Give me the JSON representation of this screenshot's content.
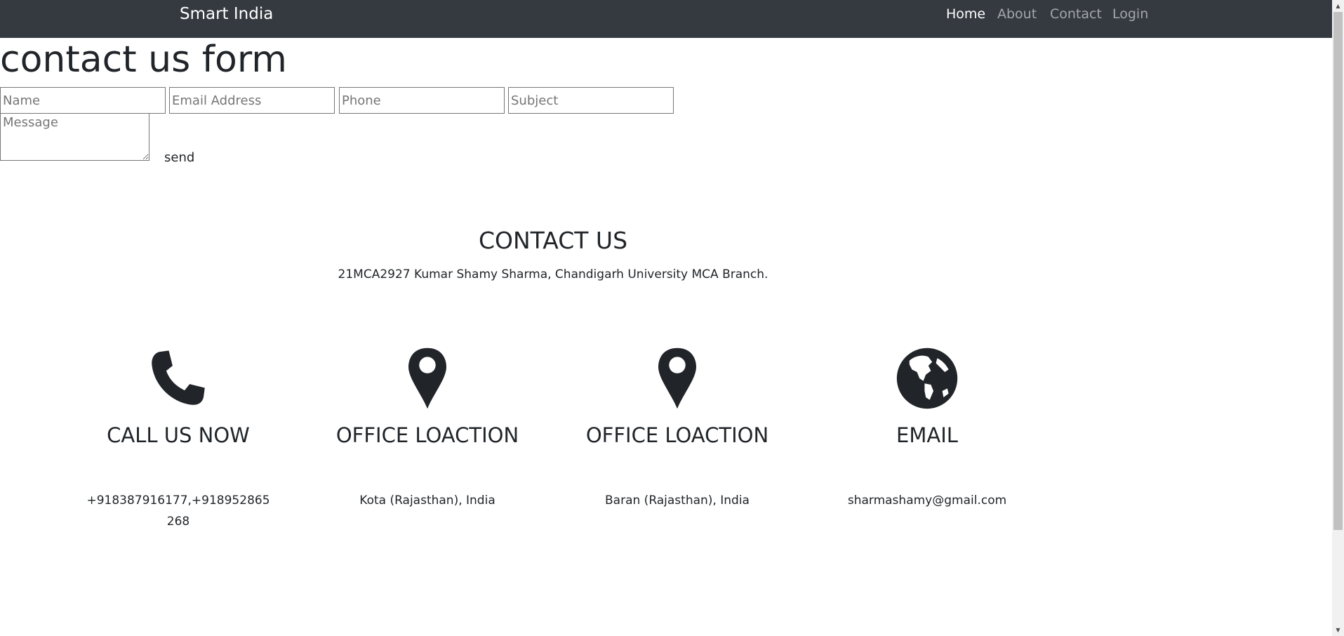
{
  "navbar": {
    "brand": "Smart India",
    "links": [
      {
        "label": "Home",
        "active": true
      },
      {
        "label": "About",
        "active": false
      },
      {
        "label": "Contact",
        "active": false
      },
      {
        "label": "Login",
        "active": false
      }
    ],
    "background": "#343a40"
  },
  "form": {
    "title": "contact us form",
    "name_placeholder": "Name",
    "email_placeholder": "Email Address",
    "phone_placeholder": "Phone",
    "subject_placeholder": "Subject",
    "message_placeholder": "Message",
    "send_label": "send"
  },
  "contact": {
    "title": "CONTACT US",
    "subtitle": "21MCA2927 Kumar Shamy Sharma, Chandigarh University MCA Branch.",
    "cards": [
      {
        "icon": "phone-icon",
        "title": "CALL US NOW",
        "text": "+918387916177,+918952865268"
      },
      {
        "icon": "map-marker-icon",
        "title": "OFFICE LOACTION",
        "text": "Kota (Rajasthan), India"
      },
      {
        "icon": "map-marker-icon",
        "title": "OFFICE LOACTION",
        "text": "Baran (Rajasthan), India"
      },
      {
        "icon": "globe-icon",
        "title": "EMAIL",
        "text": "sharmashamy@gmail.com"
      }
    ]
  },
  "colors": {
    "text": "#212529",
    "icon": "#212529"
  }
}
